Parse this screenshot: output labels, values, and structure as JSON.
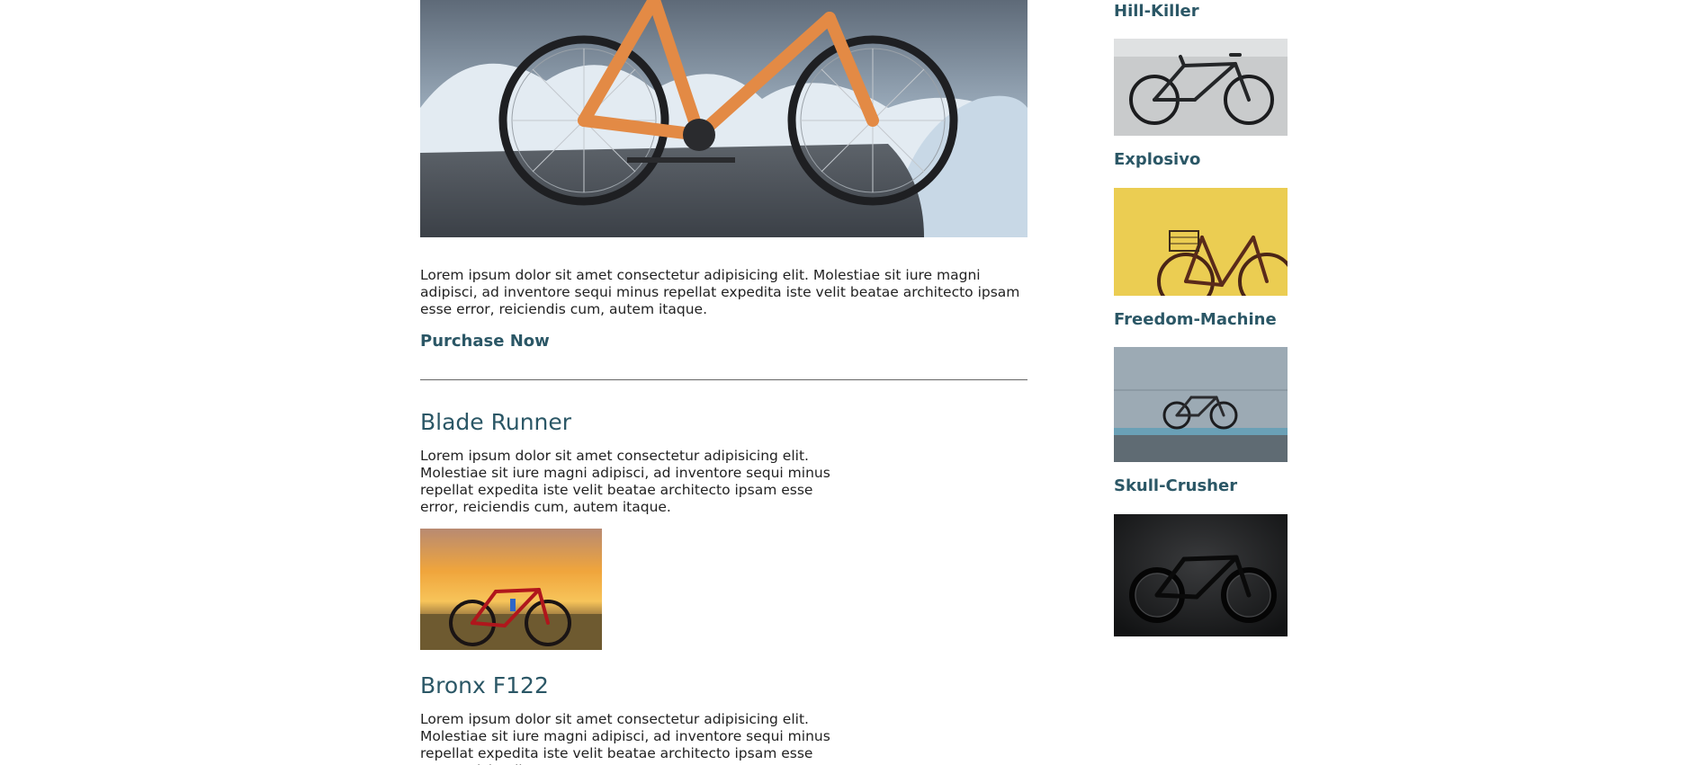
{
  "featured": {
    "description": "Lorem ipsum dolor sit amet consectetur adipisicing elit. Molestiae sit iure magni adipisci, ad inventore sequi minus repellat expedita iste velit beatae architecto ipsam esse error, reiciendis cum, autem itaque.",
    "cta_label": "Purchase Now",
    "image_icon": "bike-in-snow-photo"
  },
  "products": [
    {
      "title": "Blade Runner",
      "description": "Lorem ipsum dolor sit amet consectetur adipisicing elit. Molestiae sit iure magni adipisci, ad inventore sequi minus repellat expedita iste velit beatae architecto ipsam esse error, reiciendis cum, autem itaque.",
      "image_icon": "bike-at-sunset-photo"
    },
    {
      "title": "Bronx F122",
      "description": "Lorem ipsum dolor sit amet consectetur adipisicing elit. Molestiae sit iure magni adipisci, ad inventore sequi minus repellat expedita iste velit beatae architecto ipsam esse error, reiciendis cum,",
      "image_icon": "bike-photo"
    }
  ],
  "sidebar": {
    "items": [
      {
        "title": "Hill-Killer",
        "image_icon": "commuter-bike-photo"
      },
      {
        "title": "Explosivo",
        "image_icon": "basket-bike-photo"
      },
      {
        "title": "Freedom-Machine",
        "image_icon": "bike-against-wall-photo"
      },
      {
        "title": "Skull-Crusher",
        "image_icon": "black-road-bike-photo"
      }
    ]
  },
  "colors": {
    "heading": "#2b5766",
    "body_text": "#222222",
    "divider": "#666666",
    "bike_orange": "#e38a45"
  }
}
